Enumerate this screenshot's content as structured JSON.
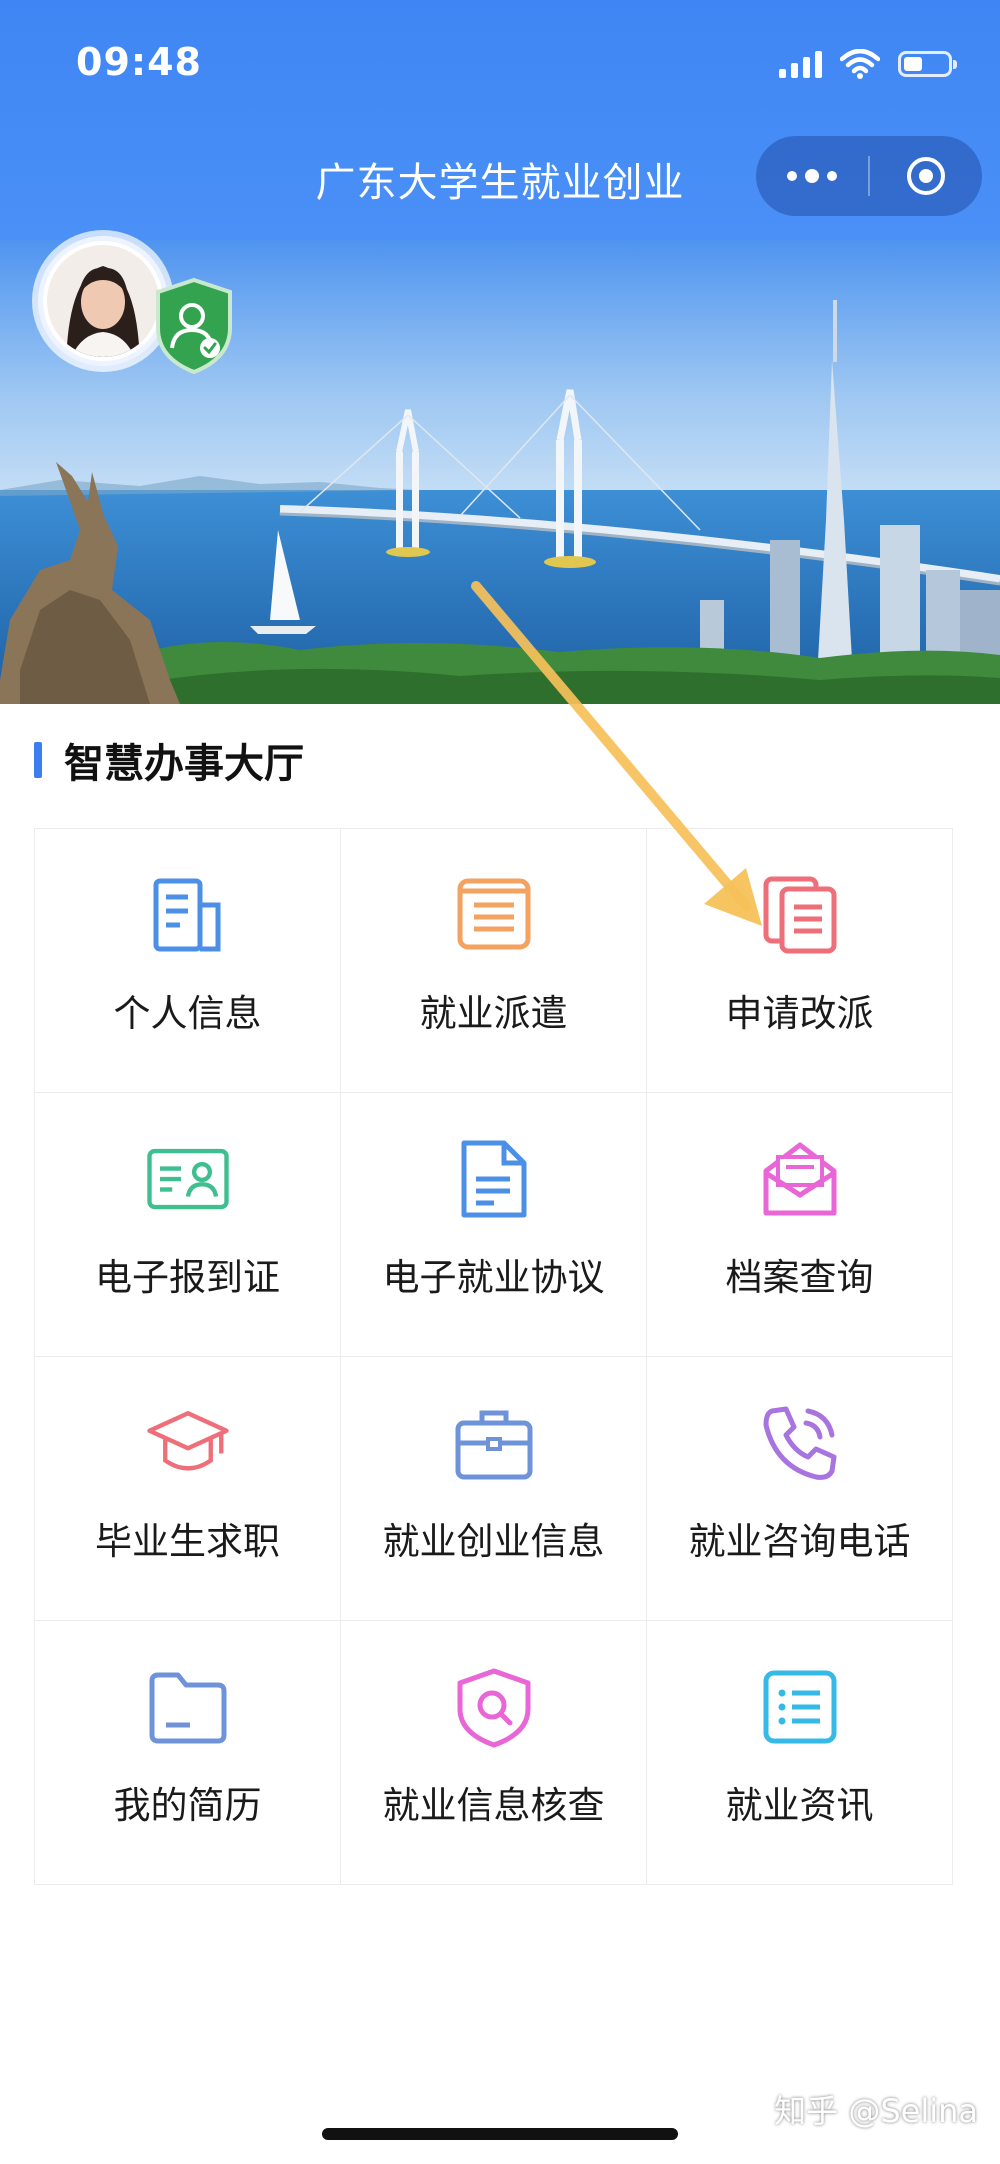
{
  "status_bar": {
    "time": "09:48"
  },
  "nav": {
    "title": "广东大学生就业创业"
  },
  "section": {
    "title": "智慧办事大厅"
  },
  "grid": {
    "items": [
      {
        "label": "个人信息"
      },
      {
        "label": "就业派遣"
      },
      {
        "label": "申请改派"
      },
      {
        "label": "电子报到证"
      },
      {
        "label": "电子就业协议"
      },
      {
        "label": "档案查询"
      },
      {
        "label": "毕业生求职"
      },
      {
        "label": "就业创业信息"
      },
      {
        "label": "就业咨询电话"
      },
      {
        "label": "我的简历"
      },
      {
        "label": "就业信息核查"
      },
      {
        "label": "就业资讯"
      }
    ]
  },
  "watermark": "知乎 @Selina",
  "colors": {
    "header_blue": "#3f86f4",
    "accent_bar": "#3d7df2",
    "arrow": "#f7c15a"
  }
}
